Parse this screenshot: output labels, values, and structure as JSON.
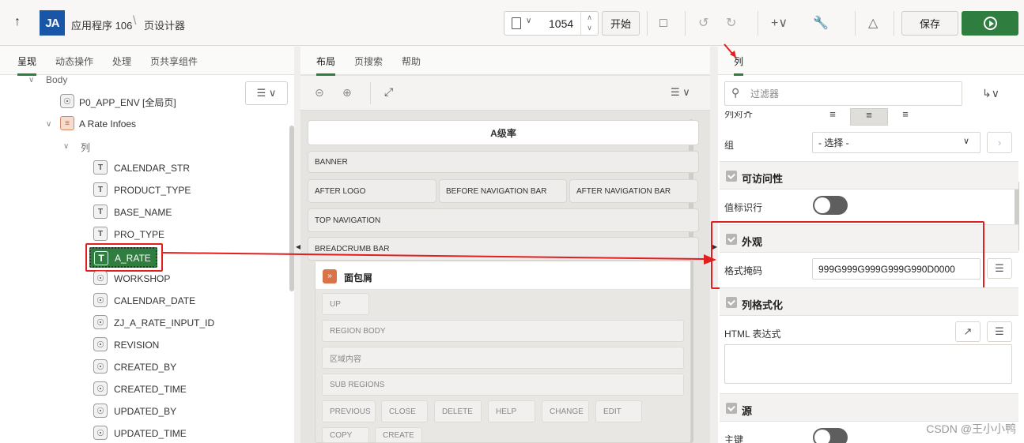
{
  "header": {
    "app": "应用程序 106",
    "page_designer": "页设计器",
    "logo": "JA",
    "page_number": "1054",
    "start_label": "开始",
    "save_label": "保存"
  },
  "left": {
    "tabs": [
      "呈现",
      "动态操作",
      "处理",
      "页共享组件"
    ],
    "body_label": "Body",
    "global_page": "P0_APP_ENV [全局页]",
    "region": "A Rate Infoes",
    "columns_label": "列",
    "visible_columns": [
      "CALENDAR_STR",
      "PRODUCT_TYPE",
      "BASE_NAME",
      "PRO_TYPE"
    ],
    "selected_column": "A_RATE",
    "hidden_columns": [
      "WORKSHOP",
      "CALENDAR_DATE",
      "ZJ_A_RATE_INPUT_ID",
      "REVISION",
      "CREATED_BY",
      "CREATED_TIME",
      "UPDATED_BY",
      "UPDATED_TIME"
    ]
  },
  "middle": {
    "tabs": [
      "布局",
      "页搜索",
      "帮助"
    ],
    "page_title": "A级率",
    "banner": "BANNER",
    "after_logo": "AFTER LOGO",
    "before_nav": "BEFORE NAVIGATION BAR",
    "after_nav": "AFTER NAVIGATION BAR",
    "top_nav": "TOP NAVIGATION",
    "breadcrumb_bar": "BREADCRUMB BAR",
    "breadcrumb_region": "面包屑",
    "up": "UP",
    "region_body": "REGION BODY",
    "region_content": "区域内容",
    "sub_regions": "SUB REGIONS",
    "buttons": [
      "PREVIOUS",
      "CLOSE",
      "DELETE",
      "HELP",
      "CHANGE",
      "EDIT"
    ],
    "buttons2": [
      "COPY",
      "CREATE"
    ]
  },
  "right": {
    "tab": "列",
    "filter_placeholder": "过滤器",
    "col_align": "列对齐",
    "group": "组",
    "group_value": "- 选择 -",
    "accessibility": "可访问性",
    "value_identifies_row": "值标识行",
    "appearance": "外观",
    "format_mask": "格式掩码",
    "format_mask_value": "999G999G999G999G990D0000",
    "column_formatting": "列格式化",
    "html_expression": "HTML 表达式",
    "source": "源",
    "primary_key": "主键"
  },
  "watermark": "CSDN @王小小鸭"
}
